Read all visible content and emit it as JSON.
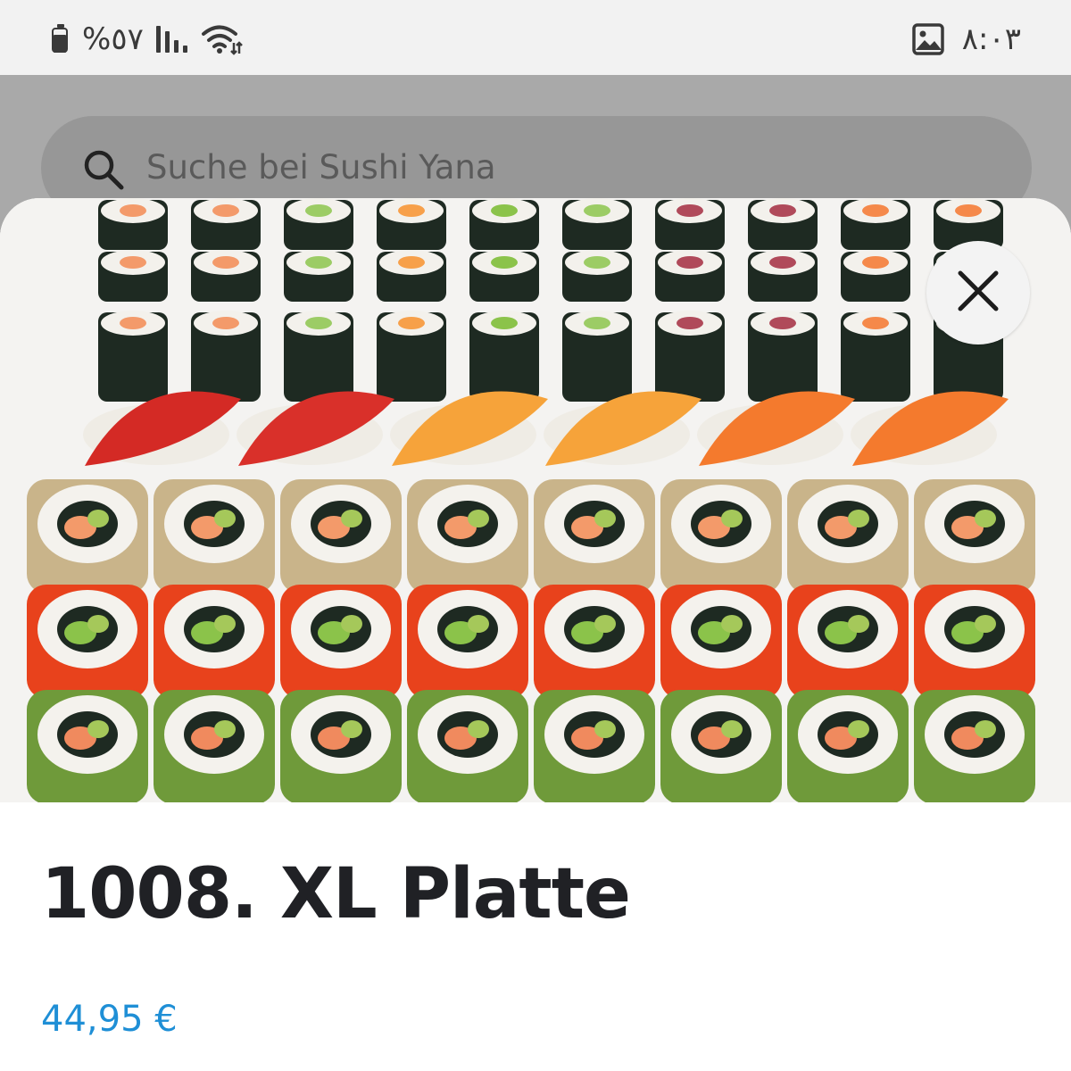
{
  "status_bar": {
    "battery_percent": "%٥٧",
    "time": "٨:٠٣",
    "icons": [
      "battery-icon",
      "signal-icon",
      "wifi-icon",
      "gallery-icon"
    ]
  },
  "search": {
    "placeholder": "Suche bei Sushi Yana"
  },
  "product": {
    "title": "1008. XL Platte",
    "price": "44,95 €",
    "image_subject": "sushi-platter",
    "price_color": "#1f8fd6"
  },
  "colors": {
    "backdrop": "#a9a9a9",
    "search_bar": "#979797",
    "title": "#202125"
  }
}
